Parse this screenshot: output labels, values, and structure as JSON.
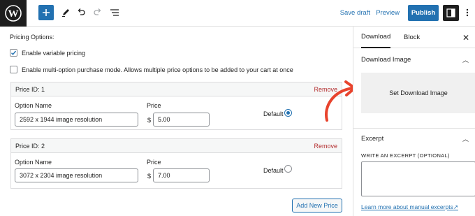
{
  "toolbar": {
    "save_draft": "Save draft",
    "preview": "Preview",
    "publish": "Publish"
  },
  "pricing": {
    "title": "Pricing Options:",
    "variable_pricing_label": "Enable variable pricing",
    "variable_pricing_checked": true,
    "multi_option_label": "Enable multi-option purchase mode. Allows multiple price options to be added to your cart at once",
    "multi_option_checked": false,
    "option_name_label": "Option Name",
    "price_label": "Price",
    "currency_symbol": "$",
    "default_label": "Default",
    "remove_label": "Remove",
    "prices": [
      {
        "id_label": "Price ID: 1",
        "option_name": "2592 x 1944 image resolution",
        "price": "5.00",
        "is_default": true
      },
      {
        "id_label": "Price ID: 2",
        "option_name": "3072 x 2304 image resolution",
        "price": "7.00",
        "is_default": false
      }
    ],
    "add_new_price": "Add New Price"
  },
  "sidebar": {
    "tabs": [
      "Download",
      "Block"
    ],
    "active_tab": "Download",
    "download_image_title": "Download Image",
    "set_download_image": "Set Download Image",
    "excerpt_title": "Excerpt",
    "excerpt_label": "WRITE AN EXCERPT (OPTIONAL)",
    "excerpt_value": "",
    "excerpt_link": "Learn more about manual excerpts"
  },
  "colors": {
    "accent": "#2271b1",
    "remove": "#b32d2e",
    "annotation_arrow": "#e8432d"
  }
}
